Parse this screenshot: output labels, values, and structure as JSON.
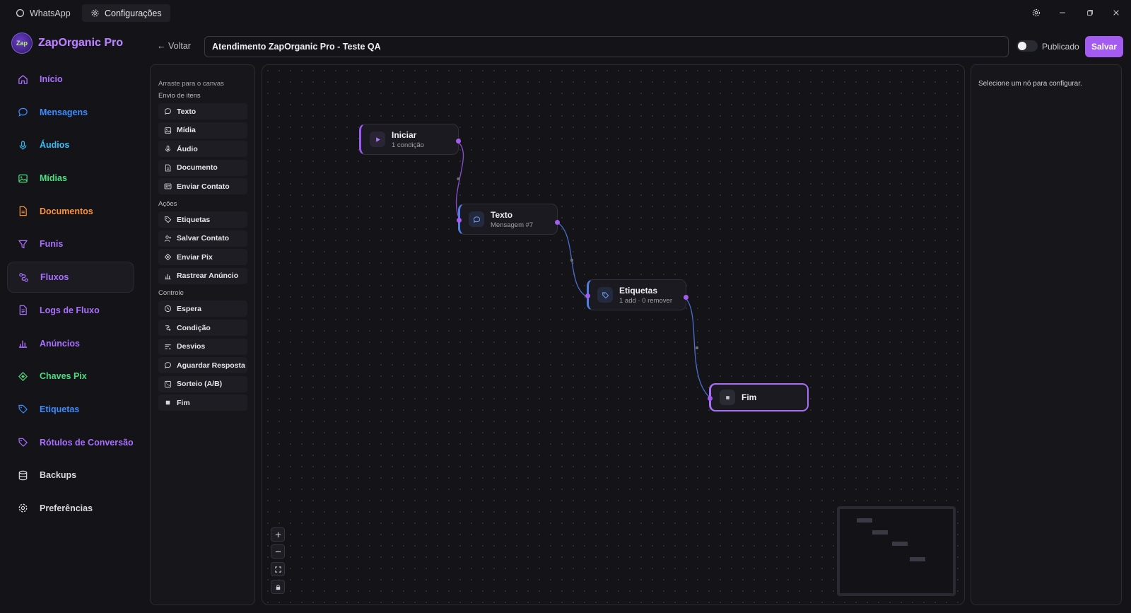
{
  "titlebar": {
    "tabs": [
      {
        "label": "WhatsApp",
        "icon": "whatsapp-icon"
      },
      {
        "label": "Configurações",
        "icon": "gear-icon"
      }
    ],
    "window_controls": [
      "settings-icon",
      "minimize-icon",
      "restore-icon",
      "close-icon"
    ]
  },
  "brand": {
    "name": "ZapOrganic Pro",
    "logo_text": "Zap"
  },
  "sidebar": {
    "items": [
      {
        "label": "Início",
        "icon": "home-icon",
        "color": "#a970ff"
      },
      {
        "label": "Mensagens",
        "icon": "chat-icon",
        "color": "#3d8bfd"
      },
      {
        "label": "Áudios",
        "icon": "mic-icon",
        "color": "#38bdf8"
      },
      {
        "label": "Mídias",
        "icon": "image-icon",
        "color": "#4ade80"
      },
      {
        "label": "Documentos",
        "icon": "document-icon",
        "color": "#fb923c"
      },
      {
        "label": "Funis",
        "icon": "funnel-icon",
        "color": "#a970ff"
      },
      {
        "label": "Fluxos",
        "icon": "flow-icon",
        "color": "#a970ff",
        "active": true
      },
      {
        "label": "Logs de Fluxo",
        "icon": "log-icon",
        "color": "#a970ff"
      },
      {
        "label": "Anúncios",
        "icon": "bar-chart-icon",
        "color": "#a970ff"
      },
      {
        "label": "Chaves Pix",
        "icon": "pix-icon",
        "color": "#4ade80"
      },
      {
        "label": "Etiquetas",
        "icon": "tag-icon",
        "color": "#3d8bfd"
      },
      {
        "label": "Rótulos de Conversão",
        "icon": "tag-icon",
        "color": "#a970ff"
      },
      {
        "label": "Backups",
        "icon": "database-icon",
        "color": "#d8d8de"
      },
      {
        "label": "Preferências",
        "icon": "gear-icon",
        "color": "#d8d8de"
      }
    ]
  },
  "header": {
    "back_label": "← Voltar",
    "flow_name": "Atendimento ZapOrganic Pro - Teste QA",
    "published_label": "Publicado",
    "published": false,
    "save_label": "Salvar",
    "accent": "#a45cf0"
  },
  "palette": {
    "hint": "Arraste para o canvas",
    "sections": [
      {
        "title": "Envio de itens",
        "items": [
          {
            "label": "Texto",
            "icon": "chat-icon"
          },
          {
            "label": "Mídia",
            "icon": "image-icon"
          },
          {
            "label": "Áudio",
            "icon": "mic-icon"
          },
          {
            "label": "Documento",
            "icon": "document-icon"
          },
          {
            "label": "Enviar Contato",
            "icon": "contact-card-icon"
          }
        ]
      },
      {
        "title": "Ações",
        "items": [
          {
            "label": "Etiquetas",
            "icon": "tag-icon"
          },
          {
            "label": "Salvar Contato",
            "icon": "user-plus-icon"
          },
          {
            "label": "Enviar Pix",
            "icon": "pix-icon"
          },
          {
            "label": "Rastrear Anúncio",
            "icon": "bar-chart-icon"
          }
        ]
      },
      {
        "title": "Controle",
        "items": [
          {
            "label": "Espera",
            "icon": "clock-icon"
          },
          {
            "label": "Condição",
            "icon": "branch-icon"
          },
          {
            "label": "Desvios",
            "icon": "split-icon"
          },
          {
            "label": "Aguardar Resposta",
            "icon": "chat-icon"
          },
          {
            "label": "Sorteio (A/B)",
            "icon": "dice-icon"
          },
          {
            "label": "Fim",
            "icon": "stop-icon"
          }
        ]
      }
    ]
  },
  "flow": {
    "nodes": [
      {
        "id": "iniciar",
        "title": "Iniciar",
        "subtitle": "1 condição",
        "icon": "play-icon"
      },
      {
        "id": "texto",
        "title": "Texto",
        "subtitle": "Mensagem #7",
        "icon": "chat-icon"
      },
      {
        "id": "etiquetas",
        "title": "Etiquetas",
        "subtitle": "1 add · 0 remover",
        "icon": "tag-icon"
      },
      {
        "id": "fim",
        "title": "Fim",
        "subtitle": "",
        "icon": "stop-icon",
        "selected": true
      }
    ]
  },
  "canvas_controls": [
    "zoom-in-icon",
    "zoom-out-icon",
    "fit-view-icon",
    "lock-icon"
  ],
  "config_panel": {
    "placeholder": "Selecione um nó para configurar."
  }
}
